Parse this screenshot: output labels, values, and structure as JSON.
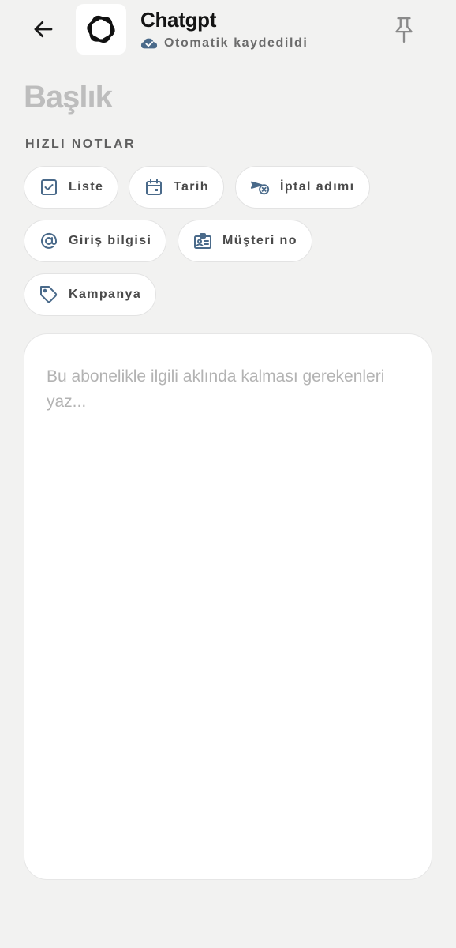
{
  "header": {
    "title": "Chatgpt",
    "save_status": "Otomatik kaydedildi",
    "accent_color": "#4a6a8a"
  },
  "title_field": {
    "placeholder": "Başlık",
    "value": ""
  },
  "quick_notes": {
    "section_label": "HIZLI NOTLAR",
    "chips": [
      {
        "label": "Liste",
        "icon": "checkbox-icon"
      },
      {
        "label": "Tarih",
        "icon": "calendar-icon"
      },
      {
        "label": "İptal adımı",
        "icon": "cancel-step-icon"
      },
      {
        "label": "Giriş bilgisi",
        "icon": "at-sign-icon"
      },
      {
        "label": "Müşteri no",
        "icon": "id-card-icon"
      },
      {
        "label": "Kampanya",
        "icon": "tag-icon"
      }
    ]
  },
  "note": {
    "placeholder": "Bu abonelikle ilgili aklında kalması gerekenleri yaz...",
    "value": ""
  }
}
